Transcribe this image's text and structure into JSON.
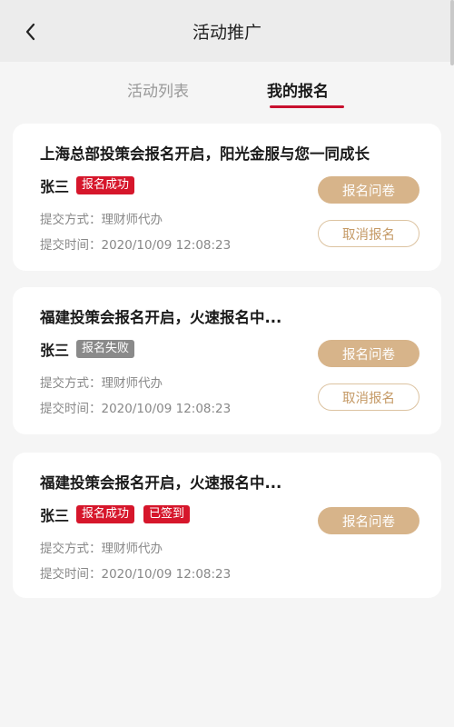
{
  "header": {
    "title": "活动推广"
  },
  "tabs": [
    {
      "label": "活动列表"
    },
    {
      "label": "我的报名"
    }
  ],
  "cards": [
    {
      "title": "上海总部投策会报名开启，阳光金服与您一同成长",
      "name": "张三",
      "badges": [
        "报名成功"
      ],
      "submit_method": "提交方式：理财师代办",
      "submit_time": "提交时间：2020/10/09  12:08:23",
      "primary_button": "报名问卷",
      "secondary_button": "取消报名"
    },
    {
      "title": "福建投策会报名开启，火速报名中...",
      "name": "张三",
      "badges": [
        "报名失败"
      ],
      "submit_method": "提交方式：理财师代办",
      "submit_time": "提交时间：2020/10/09  12:08:23",
      "primary_button": "报名问卷",
      "secondary_button": "取消报名"
    },
    {
      "title": "福建投策会报名开启，火速报名中...",
      "name": "张三",
      "badges": [
        "报名成功",
        "已签到"
      ],
      "submit_method": "提交方式：理财师代办",
      "submit_time": "提交时间：2020/10/09  12:08:23",
      "primary_button": "报名问卷"
    }
  ],
  "colors": {
    "accent_red": "#c8102e",
    "badge_red": "#d6162b",
    "badge_gray": "#8a8a8a",
    "button_gold": "#d7b48a"
  }
}
